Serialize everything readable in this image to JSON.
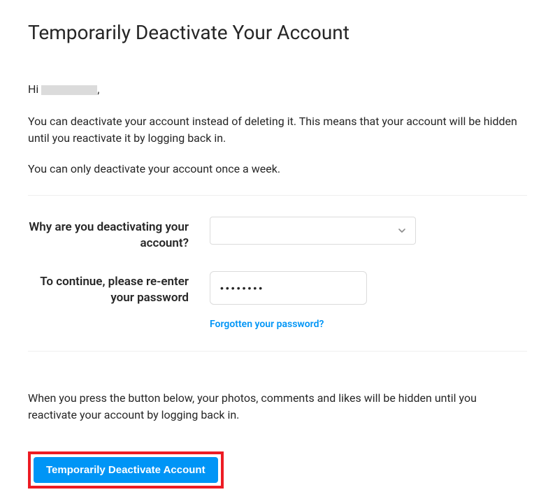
{
  "title": "Temporarily Deactivate Your Account",
  "greeting_prefix": "Hi ",
  "greeting_suffix": ",",
  "paragraph1": "You can deactivate your account instead of deleting it. This means that your account will be hidden until you reactivate it by logging back in.",
  "paragraph2": "You can only deactivate your account once a week.",
  "form": {
    "reason_label": "Why are you deactivating your account?",
    "reason_value": "",
    "password_label": "To continue, please re-enter your password",
    "password_value": "••••••••",
    "forgot_link": "Forgotten your password?"
  },
  "footer_text": "When you press the button below, your photos, comments and likes will be hidden until you reactivate your account by logging back in.",
  "button_label": "Temporarily Deactivate Account"
}
